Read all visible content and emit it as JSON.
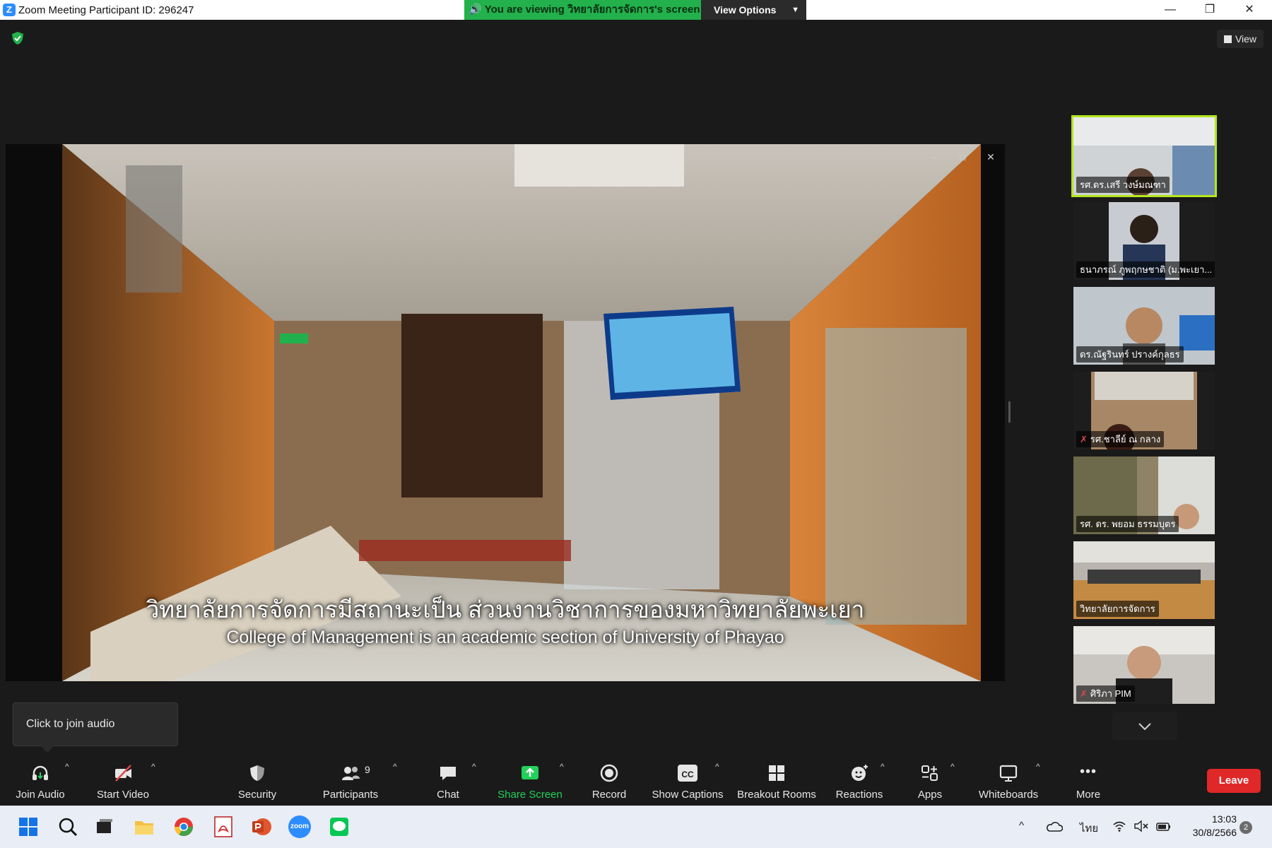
{
  "window": {
    "title": "Zoom Meeting Participant ID: 296247",
    "logo_letter": "Z",
    "minimize": "—",
    "restore": "❐",
    "close": "✕"
  },
  "banner": {
    "viewing_text": "You are viewing วิทยาลัยการจัดการ's screen",
    "view_options": "View Options"
  },
  "top": {
    "view_label": "View"
  },
  "shared_screen": {
    "subtitle_th": "วิทยาลัยการจัดการมีสถานะเป็น ส่วนงานวิชาการของมหาวิทยาลัยพะเยา",
    "subtitle_en": "College of Management is an academic section of University of Phayao",
    "btn_min": "–",
    "btn_max": "⧉",
    "btn_close": "✕"
  },
  "participants": [
    {
      "name": "รศ.ดร.เสรี วงษ์มณฑา",
      "muted": false,
      "active": true
    },
    {
      "name": "ธนาภรณ์ ภูพฤกษชาติ (ม.พะเยา...",
      "muted": false,
      "active": false
    },
    {
      "name": "ดร.ณัฐรินทร์ ปรางค์กุลธร",
      "muted": false,
      "active": false
    },
    {
      "name": "รศ.ชาลีย์ ณ กลาง",
      "muted": true,
      "active": false
    },
    {
      "name": "รศ. ดร. พยอม ธรรมบุตร",
      "muted": false,
      "active": false
    },
    {
      "name": "วิทยาลัยการจัดการ",
      "muted": false,
      "active": false
    },
    {
      "name": "ศิริภา PIM",
      "muted": true,
      "active": false
    }
  ],
  "tooltip": {
    "text": "Click to join audio"
  },
  "toolbar": {
    "join_audio": "Join Audio",
    "start_video": "Start Video",
    "security": "Security",
    "participants": "Participants",
    "participants_count": "9",
    "chat": "Chat",
    "share_screen": "Share Screen",
    "record": "Record",
    "show_captions": "Show Captions",
    "captions_glyph": "CC",
    "breakout_rooms": "Breakout Rooms",
    "reactions": "Reactions",
    "apps": "Apps",
    "whiteboards": "Whiteboards",
    "more": "More",
    "more_glyph": "•••",
    "leave": "Leave",
    "caret": "^"
  },
  "taskbar": {
    "zoom_app_label": "zoom",
    "tray_chevron": "^",
    "language": "ไทย",
    "time": "13:03",
    "date": "30/8/2566",
    "notifications": "2"
  },
  "colors": {
    "banner_green": "#22b14c",
    "share_green": "#22d05a",
    "active_speaker": "#b5e61d",
    "leave_red": "#e02828",
    "zoom_blue": "#2d8cff"
  }
}
